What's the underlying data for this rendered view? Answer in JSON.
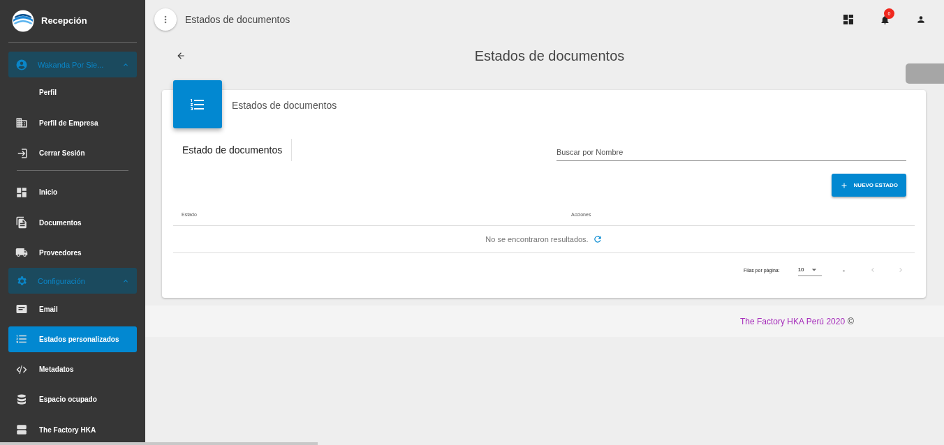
{
  "sidebar": {
    "brand": "Recepción",
    "user_menu": {
      "label": "Wakanda Por Sie...",
      "expanded": true,
      "children": [
        {
          "label": "Perfil",
          "selected": false
        },
        {
          "label": "Perfil de Empresa",
          "selected": false
        },
        {
          "label": "Cerrar Sesión",
          "selected": false
        }
      ]
    },
    "nav": [
      {
        "label": "Inicio",
        "selected": false
      },
      {
        "label": "Documentos",
        "selected": false
      },
      {
        "label": "Proveedores",
        "selected": false
      },
      {
        "label": "Configuración",
        "expanded": true,
        "children": [
          {
            "label": "Email",
            "selected": false
          },
          {
            "label": "Estados personalizados",
            "selected": true
          },
          {
            "label": "Metadatos",
            "selected": false
          },
          {
            "label": "Espacio ocupado",
            "selected": false
          }
        ]
      },
      {
        "label": "The Factory HKA",
        "selected": false
      }
    ]
  },
  "topbar": {
    "title": "Estados de documentos",
    "notifications": "0"
  },
  "page_title": "Estados de documentos",
  "card": {
    "title": "Estados de documentos",
    "tab": "Estado de documentos",
    "search": {
      "placeholder": "Buscar por Nombre"
    },
    "new_button": "NUEVO ESTADO",
    "table": {
      "columns": [
        "Estado",
        "Acciones"
      ],
      "empty_message": "No se encontraron resultados."
    },
    "pagination": {
      "rows_label": "Filas por página:",
      "rows_value": "10",
      "range": "-"
    }
  },
  "footer": {
    "link": "The Factory HKA Perú 2020",
    "symbol": "©"
  }
}
